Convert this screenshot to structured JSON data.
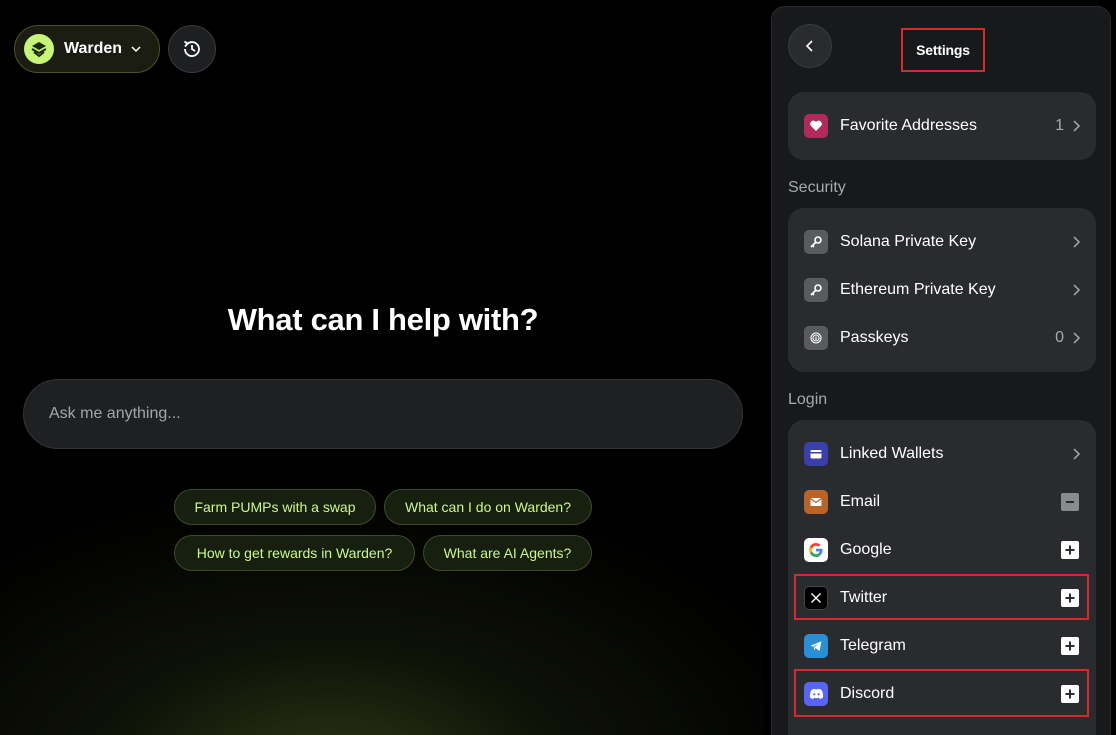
{
  "app": {
    "name": "Warden",
    "brand_color": "#c6f57a",
    "brand_icon": "warden-logo-icon",
    "history_icon": "history-icon"
  },
  "main": {
    "headline": "What can I help with?",
    "input_placeholder": "Ask me anything...",
    "suggestions": [
      "Farm PUMPs with a swap",
      "What can I do on Warden?",
      "How to get rewards in Warden?",
      "What are AI Agents?"
    ]
  },
  "settings": {
    "title": "Settings",
    "back_icon": "chevron-left-icon",
    "favorites": {
      "label": "Favorite Addresses",
      "count": "1",
      "icon": "heart-icon",
      "color": "#b02a5a"
    },
    "security": {
      "label": "Security",
      "items": [
        {
          "label": "Solana Private Key",
          "icon": "key-icon"
        },
        {
          "label": "Ethereum Private Key",
          "icon": "key-icon"
        },
        {
          "label": "Passkeys",
          "count": "0",
          "icon": "fingerprint-icon"
        }
      ]
    },
    "login": {
      "label": "Login",
      "items": [
        {
          "label": "Linked Wallets",
          "icon": "wallet-icon",
          "action": "chevron",
          "color": "#3b3fa8"
        },
        {
          "label": "Email",
          "icon": "mail-icon",
          "action": "minus",
          "color": "#b5642a"
        },
        {
          "label": "Google",
          "icon": "google-icon",
          "action": "plus",
          "color": "#ffffff"
        },
        {
          "label": "Twitter",
          "icon": "x-icon",
          "action": "plus",
          "color": "#000000"
        },
        {
          "label": "Telegram",
          "icon": "telegram-icon",
          "action": "plus",
          "color": "#2a8fd4"
        },
        {
          "label": "Discord",
          "icon": "discord-icon",
          "action": "plus",
          "color": "#5865f2"
        }
      ]
    }
  },
  "highlight_color": "#d32b2b"
}
